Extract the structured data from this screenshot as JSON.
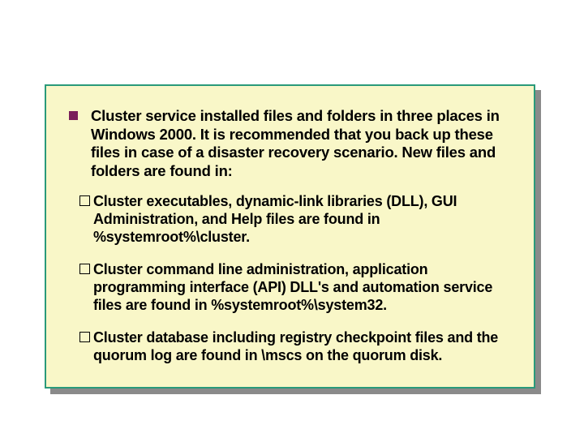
{
  "panel": {
    "intro": "Cluster service installed files and folders in three places in Windows 2000. It is recommended that you back up these files in case of a disaster recovery scenario. New files and folders are found in:",
    "items": [
      "Cluster executables, dynamic-link libraries (DLL), GUI Administration, and Help files are found in %systemroot%\\cluster.",
      "Cluster command line administration, application programming interface (API) DLL's and automation service files are found in %systemroot%\\system32.",
      "Cluster database including registry checkpoint files and the quorum log are found in \\mscs on the quorum disk."
    ]
  }
}
